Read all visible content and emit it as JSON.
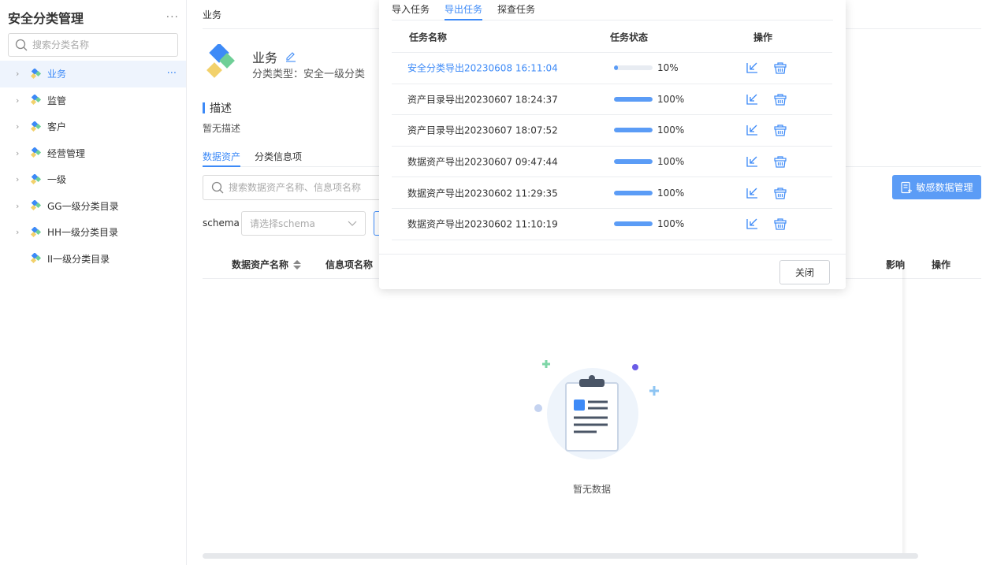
{
  "sidebar": {
    "title": "安全分类管理",
    "more_label": "···",
    "search_placeholder": "搜索分类名称",
    "items": [
      {
        "label": "业务",
        "active": true,
        "has_children": true
      },
      {
        "label": "监管",
        "active": false,
        "has_children": true
      },
      {
        "label": "客户",
        "active": false,
        "has_children": true
      },
      {
        "label": "经营管理",
        "active": false,
        "has_children": true
      },
      {
        "label": "一级",
        "active": false,
        "has_children": true
      },
      {
        "label": "GG一级分类目录",
        "active": false,
        "has_children": true
      },
      {
        "label": "HH一级分类目录",
        "active": false,
        "has_children": true
      },
      {
        "label": "II一级分类目录",
        "active": false,
        "has_children": false
      }
    ],
    "item_more_label": "···"
  },
  "main": {
    "breadcrumb": "业务",
    "category_name": "业务",
    "category_type": "分类类型：安全一级分类",
    "description_title": "描述",
    "description_text": "暂无描述",
    "tabs": [
      {
        "label": "数据资产",
        "active": true
      },
      {
        "label": "分类信息项",
        "active": false
      }
    ],
    "search_placeholder": "搜索数据资产名称、信息项名称",
    "schema_label": "schema",
    "schema_placeholder": "请选择schema",
    "sensitive_button": "敏感数据管理",
    "table_headers": {
      "asset_name": "数据资产名称",
      "info_item": "信息项名称",
      "effect": "影响",
      "operation": "操作"
    },
    "empty_text": "暂无数据"
  },
  "popup": {
    "tabs": [
      {
        "label": "导入任务",
        "active": false
      },
      {
        "label": "导出任务",
        "active": true
      },
      {
        "label": "探查任务",
        "active": false
      }
    ],
    "headers": {
      "name": "任务名称",
      "status": "任务状态",
      "op": "操作"
    },
    "rows": [
      {
        "name": "安全分类导出20230608 16:11:04",
        "progress": 10,
        "progress_label": "10%",
        "link": true
      },
      {
        "name": "资产目录导出20230607 18:24:37",
        "progress": 100,
        "progress_label": "100%",
        "link": false
      },
      {
        "name": "资产目录导出20230607 18:07:52",
        "progress": 100,
        "progress_label": "100%",
        "link": false
      },
      {
        "name": "数据资产导出20230607 09:47:44",
        "progress": 100,
        "progress_label": "100%",
        "link": false
      },
      {
        "name": "数据资产导出20230602 11:29:35",
        "progress": 100,
        "progress_label": "100%",
        "link": false
      },
      {
        "name": "数据资产导出20230602 11:10:19",
        "progress": 100,
        "progress_label": "100%",
        "link": false
      }
    ],
    "close_label": "关闭"
  },
  "colors": {
    "accent": "#3d8af7",
    "button": "#5b9cf6"
  }
}
